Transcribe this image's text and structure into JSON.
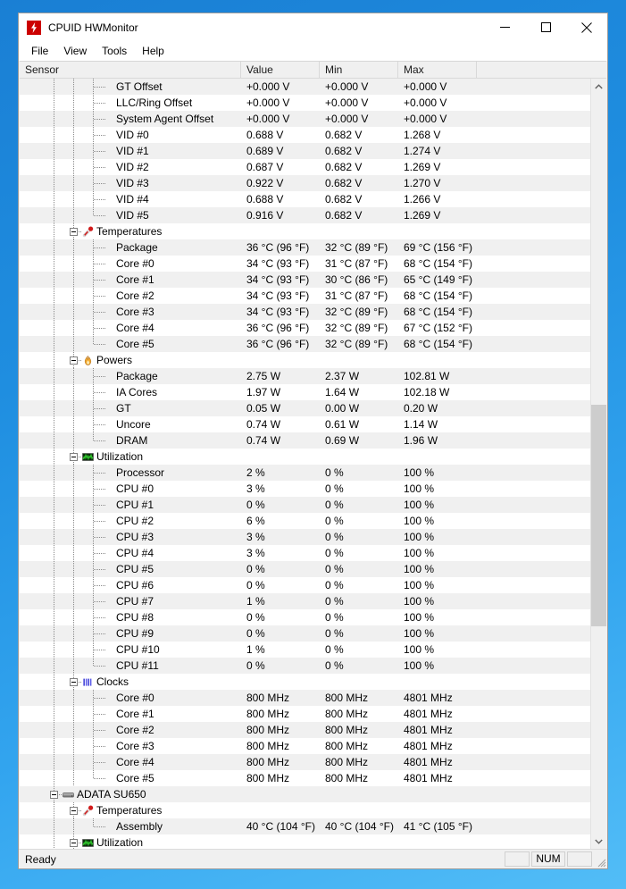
{
  "window": {
    "title": "CPUID HWMonitor",
    "icon": "lightning-bolt-icon",
    "minimize_label": "Minimize",
    "maximize_label": "Maximize",
    "close_label": "Close"
  },
  "menu": {
    "items": [
      {
        "label": "File"
      },
      {
        "label": "View"
      },
      {
        "label": "Tools"
      },
      {
        "label": "Help"
      }
    ]
  },
  "columns": {
    "sensor": "Sensor",
    "value": "Value",
    "min": "Min",
    "max": "Max"
  },
  "statusbar": {
    "text": "Ready",
    "pane1": "",
    "num": "NUM",
    "pane3": ""
  },
  "scrollbar": {
    "up_arrow": "chevron-up-icon",
    "down_arrow": "chevron-down-icon"
  },
  "rows": [
    {
      "type": "leaf",
      "depth": 3,
      "label": "GT Offset",
      "value": "+0.000 V",
      "min": "+0.000 V",
      "max": "+0.000 V"
    },
    {
      "type": "leaf",
      "depth": 3,
      "label": "LLC/Ring Offset",
      "value": "+0.000 V",
      "min": "+0.000 V",
      "max": "+0.000 V"
    },
    {
      "type": "leaf",
      "depth": 3,
      "label": "System Agent Offset",
      "value": "+0.000 V",
      "min": "+0.000 V",
      "max": "+0.000 V"
    },
    {
      "type": "leaf",
      "depth": 3,
      "label": "VID #0",
      "value": "0.688 V",
      "min": "0.682 V",
      "max": "1.268 V"
    },
    {
      "type": "leaf",
      "depth": 3,
      "label": "VID #1",
      "value": "0.689 V",
      "min": "0.682 V",
      "max": "1.274 V"
    },
    {
      "type": "leaf",
      "depth": 3,
      "label": "VID #2",
      "value": "0.687 V",
      "min": "0.682 V",
      "max": "1.269 V"
    },
    {
      "type": "leaf",
      "depth": 3,
      "label": "VID #3",
      "value": "0.922 V",
      "min": "0.682 V",
      "max": "1.270 V"
    },
    {
      "type": "leaf",
      "depth": 3,
      "label": "VID #4",
      "value": "0.688 V",
      "min": "0.682 V",
      "max": "1.266 V"
    },
    {
      "type": "leaf",
      "depth": 3,
      "label": "VID #5",
      "value": "0.916 V",
      "min": "0.682 V",
      "max": "1.269 V",
      "last": true
    },
    {
      "type": "group",
      "depth": 2,
      "label": "Temperatures",
      "icon": "thermometer-icon",
      "value": "",
      "min": "",
      "max": ""
    },
    {
      "type": "leaf",
      "depth": 3,
      "label": "Package",
      "value": "36 °C  (96 °F)",
      "min": "32 °C  (89 °F)",
      "max": "69 °C  (156 °F)"
    },
    {
      "type": "leaf",
      "depth": 3,
      "label": "Core #0",
      "value": "34 °C  (93 °F)",
      "min": "31 °C  (87 °F)",
      "max": "68 °C  (154 °F)"
    },
    {
      "type": "leaf",
      "depth": 3,
      "label": "Core #1",
      "value": "34 °C  (93 °F)",
      "min": "30 °C  (86 °F)",
      "max": "65 °C  (149 °F)"
    },
    {
      "type": "leaf",
      "depth": 3,
      "label": "Core #2",
      "value": "34 °C  (93 °F)",
      "min": "31 °C  (87 °F)",
      "max": "68 °C  (154 °F)"
    },
    {
      "type": "leaf",
      "depth": 3,
      "label": "Core #3",
      "value": "34 °C  (93 °F)",
      "min": "32 °C  (89 °F)",
      "max": "68 °C  (154 °F)"
    },
    {
      "type": "leaf",
      "depth": 3,
      "label": "Core #4",
      "value": "36 °C  (96 °F)",
      "min": "32 °C  (89 °F)",
      "max": "67 °C  (152 °F)"
    },
    {
      "type": "leaf",
      "depth": 3,
      "label": "Core #5",
      "value": "36 °C  (96 °F)",
      "min": "32 °C  (89 °F)",
      "max": "68 °C  (154 °F)",
      "last": true
    },
    {
      "type": "group",
      "depth": 2,
      "label": "Powers",
      "icon": "flame-icon",
      "value": "",
      "min": "",
      "max": ""
    },
    {
      "type": "leaf",
      "depth": 3,
      "label": "Package",
      "value": "2.75 W",
      "min": "2.37 W",
      "max": "102.81 W"
    },
    {
      "type": "leaf",
      "depth": 3,
      "label": "IA Cores",
      "value": "1.97 W",
      "min": "1.64 W",
      "max": "102.18 W"
    },
    {
      "type": "leaf",
      "depth": 3,
      "label": "GT",
      "value": "0.05 W",
      "min": "0.00 W",
      "max": "0.20 W"
    },
    {
      "type": "leaf",
      "depth": 3,
      "label": "Uncore",
      "value": "0.74 W",
      "min": "0.61 W",
      "max": "1.14 W"
    },
    {
      "type": "leaf",
      "depth": 3,
      "label": "DRAM",
      "value": "0.74 W",
      "min": "0.69 W",
      "max": "1.96 W",
      "last": true
    },
    {
      "type": "group",
      "depth": 2,
      "label": "Utilization",
      "icon": "graph-icon",
      "value": "",
      "min": "",
      "max": ""
    },
    {
      "type": "leaf",
      "depth": 3,
      "label": "Processor",
      "value": "2 %",
      "min": "0 %",
      "max": "100 %"
    },
    {
      "type": "leaf",
      "depth": 3,
      "label": "CPU #0",
      "value": "3 %",
      "min": "0 %",
      "max": "100 %"
    },
    {
      "type": "leaf",
      "depth": 3,
      "label": "CPU #1",
      "value": "0 %",
      "min": "0 %",
      "max": "100 %"
    },
    {
      "type": "leaf",
      "depth": 3,
      "label": "CPU #2",
      "value": "6 %",
      "min": "0 %",
      "max": "100 %"
    },
    {
      "type": "leaf",
      "depth": 3,
      "label": "CPU #3",
      "value": "3 %",
      "min": "0 %",
      "max": "100 %"
    },
    {
      "type": "leaf",
      "depth": 3,
      "label": "CPU #4",
      "value": "3 %",
      "min": "0 %",
      "max": "100 %"
    },
    {
      "type": "leaf",
      "depth": 3,
      "label": "CPU #5",
      "value": "0 %",
      "min": "0 %",
      "max": "100 %"
    },
    {
      "type": "leaf",
      "depth": 3,
      "label": "CPU #6",
      "value": "0 %",
      "min": "0 %",
      "max": "100 %"
    },
    {
      "type": "leaf",
      "depth": 3,
      "label": "CPU #7",
      "value": "1 %",
      "min": "0 %",
      "max": "100 %"
    },
    {
      "type": "leaf",
      "depth": 3,
      "label": "CPU #8",
      "value": "0 %",
      "min": "0 %",
      "max": "100 %"
    },
    {
      "type": "leaf",
      "depth": 3,
      "label": "CPU #9",
      "value": "0 %",
      "min": "0 %",
      "max": "100 %"
    },
    {
      "type": "leaf",
      "depth": 3,
      "label": "CPU #10",
      "value": "1 %",
      "min": "0 %",
      "max": "100 %"
    },
    {
      "type": "leaf",
      "depth": 3,
      "label": "CPU #11",
      "value": "0 %",
      "min": "0 %",
      "max": "100 %",
      "last": true
    },
    {
      "type": "group",
      "depth": 2,
      "label": "Clocks",
      "icon": "clock-bars-icon",
      "value": "",
      "min": "",
      "max": ""
    },
    {
      "type": "leaf",
      "depth": 3,
      "label": "Core #0",
      "value": "800 MHz",
      "min": "800 MHz",
      "max": "4801 MHz"
    },
    {
      "type": "leaf",
      "depth": 3,
      "label": "Core #1",
      "value": "800 MHz",
      "min": "800 MHz",
      "max": "4801 MHz"
    },
    {
      "type": "leaf",
      "depth": 3,
      "label": "Core #2",
      "value": "800 MHz",
      "min": "800 MHz",
      "max": "4801 MHz"
    },
    {
      "type": "leaf",
      "depth": 3,
      "label": "Core #3",
      "value": "800 MHz",
      "min": "800 MHz",
      "max": "4801 MHz"
    },
    {
      "type": "leaf",
      "depth": 3,
      "label": "Core #4",
      "value": "800 MHz",
      "min": "800 MHz",
      "max": "4801 MHz"
    },
    {
      "type": "leaf",
      "depth": 3,
      "label": "Core #5",
      "value": "800 MHz",
      "min": "800 MHz",
      "max": "4801 MHz",
      "last": true
    },
    {
      "type": "group",
      "depth": 1,
      "label": "ADATA SU650",
      "icon": "drive-icon",
      "value": "",
      "min": "",
      "max": ""
    },
    {
      "type": "group",
      "depth": 2,
      "label": "Temperatures",
      "icon": "thermometer-icon",
      "value": "",
      "min": "",
      "max": ""
    },
    {
      "type": "leaf",
      "depth": 3,
      "label": "Assembly",
      "value": "40 °C  (104 °F)",
      "min": "40 °C  (104 °F)",
      "max": "41 °C  (105 °F)",
      "last": true
    },
    {
      "type": "group",
      "depth": 2,
      "label": "Utilization",
      "icon": "graph-icon",
      "value": "",
      "min": "",
      "max": ""
    }
  ]
}
